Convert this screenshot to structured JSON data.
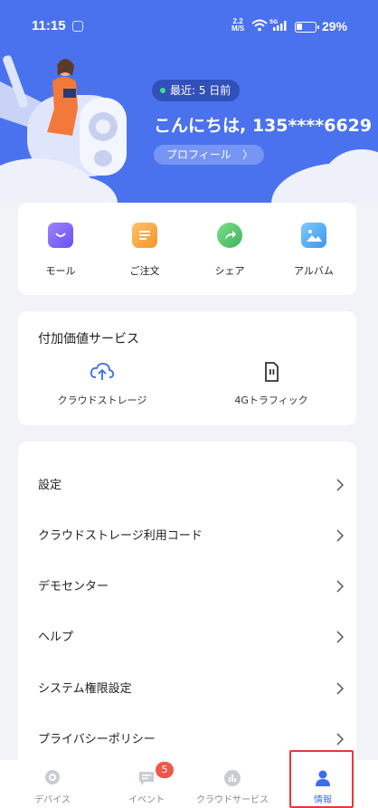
{
  "status_bar": {
    "time": "11:15",
    "net_speed_value": "2.2",
    "net_speed_unit": "M/S",
    "battery": "29%"
  },
  "header": {
    "last_seen": "最近: 5 日前",
    "greeting": "こんにちは, 135****6629",
    "profile_label": "プロフィール",
    "profile_chevron": "〉"
  },
  "quick_actions": [
    {
      "label": "モール",
      "icon": "shopping-bag-icon",
      "color": "#7b62f5"
    },
    {
      "label": "ご注文",
      "icon": "order-list-icon",
      "color": "#f5a23c"
    },
    {
      "label": "シェア",
      "icon": "share-icon",
      "color": "#4cc46a"
    },
    {
      "label": "アルバム",
      "icon": "album-icon",
      "color": "#4aa9f0"
    }
  ],
  "value_services": {
    "title": "付加価値サービス",
    "items": [
      {
        "label": "クラウドストレージ",
        "icon": "cloud-upload-icon"
      },
      {
        "label": "4Gトラフィック",
        "icon": "sim-card-icon"
      }
    ]
  },
  "menu": [
    {
      "label": "設定"
    },
    {
      "label": "クラウドストレージ利用コード"
    },
    {
      "label": "デモセンター"
    },
    {
      "label": "ヘルプ"
    },
    {
      "label": "システム権限設定"
    },
    {
      "label": "プライバシーポリシー"
    }
  ],
  "bottom_nav": [
    {
      "label": "デバイス",
      "icon": "camera-icon"
    },
    {
      "label": "イベント",
      "icon": "message-icon",
      "badge": "5"
    },
    {
      "label": "クラウドサービス",
      "icon": "cloud-service-icon"
    },
    {
      "label": "情報",
      "icon": "person-icon",
      "active": true
    }
  ],
  "colors": {
    "header_bg": "#4a72ee",
    "accent": "#3a6df0",
    "badge": "#f0564a",
    "highlight": "#e53935"
  }
}
